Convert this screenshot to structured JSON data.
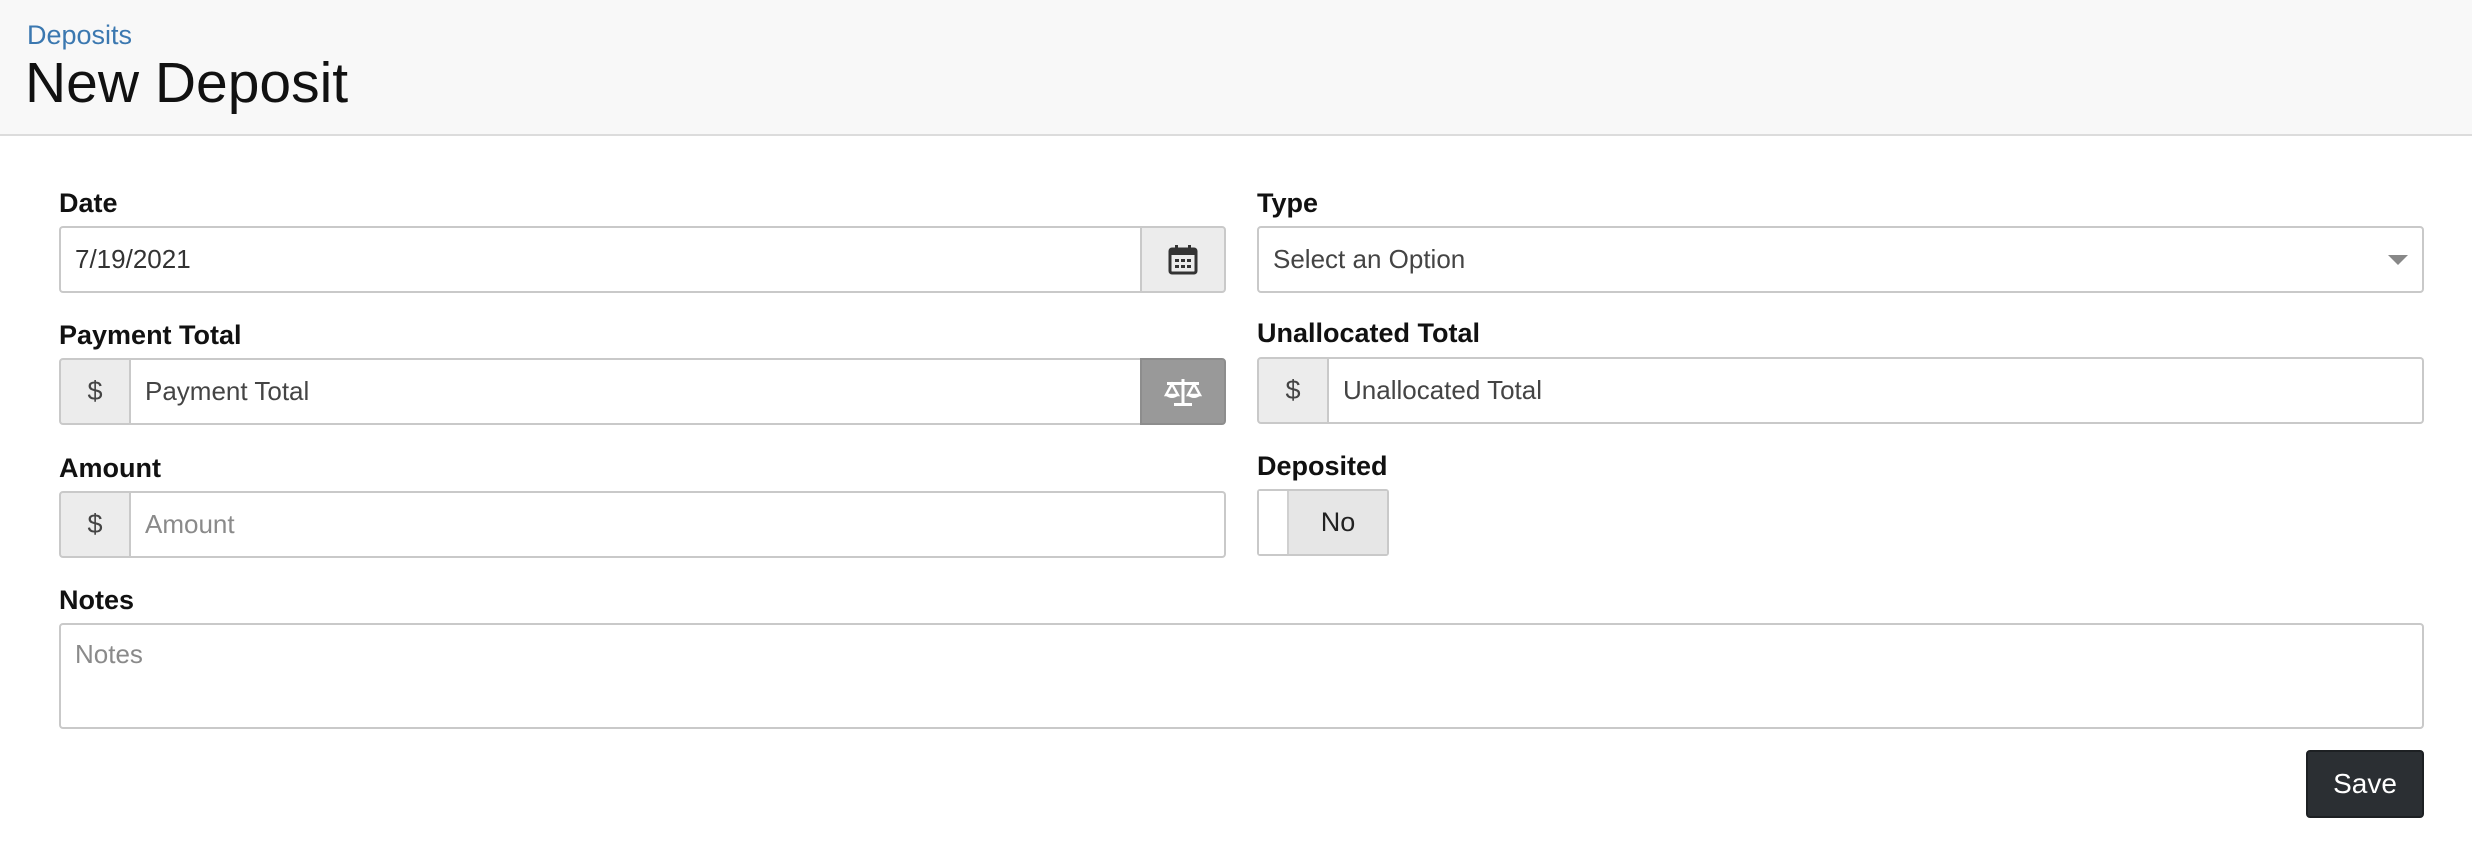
{
  "breadcrumb": {
    "label": "Deposits"
  },
  "page": {
    "title": "New Deposit"
  },
  "form": {
    "date": {
      "label": "Date",
      "value": "7/19/2021"
    },
    "type": {
      "label": "Type",
      "selected": "Select an Option"
    },
    "payment_total": {
      "label": "Payment Total",
      "prefix": "$",
      "placeholder": "Payment Total"
    },
    "unallocated_total": {
      "label": "Unallocated Total",
      "prefix": "$",
      "placeholder": "Unallocated Total"
    },
    "amount": {
      "label": "Amount",
      "prefix": "$",
      "placeholder": "Amount"
    },
    "deposited": {
      "label": "Deposited",
      "state": "No"
    },
    "notes": {
      "label": "Notes",
      "placeholder": "Notes"
    },
    "save_label": "Save"
  },
  "icons": {
    "date_button": "calendar-icon",
    "payment_button": "balance-scale-icon",
    "type_dropdown": "chevron-down-icon"
  },
  "colors": {
    "link": "#3b78b0",
    "header_bg": "#f8f8f8",
    "save_bg": "#2b2f33",
    "balance_btn_bg": "#999999"
  }
}
